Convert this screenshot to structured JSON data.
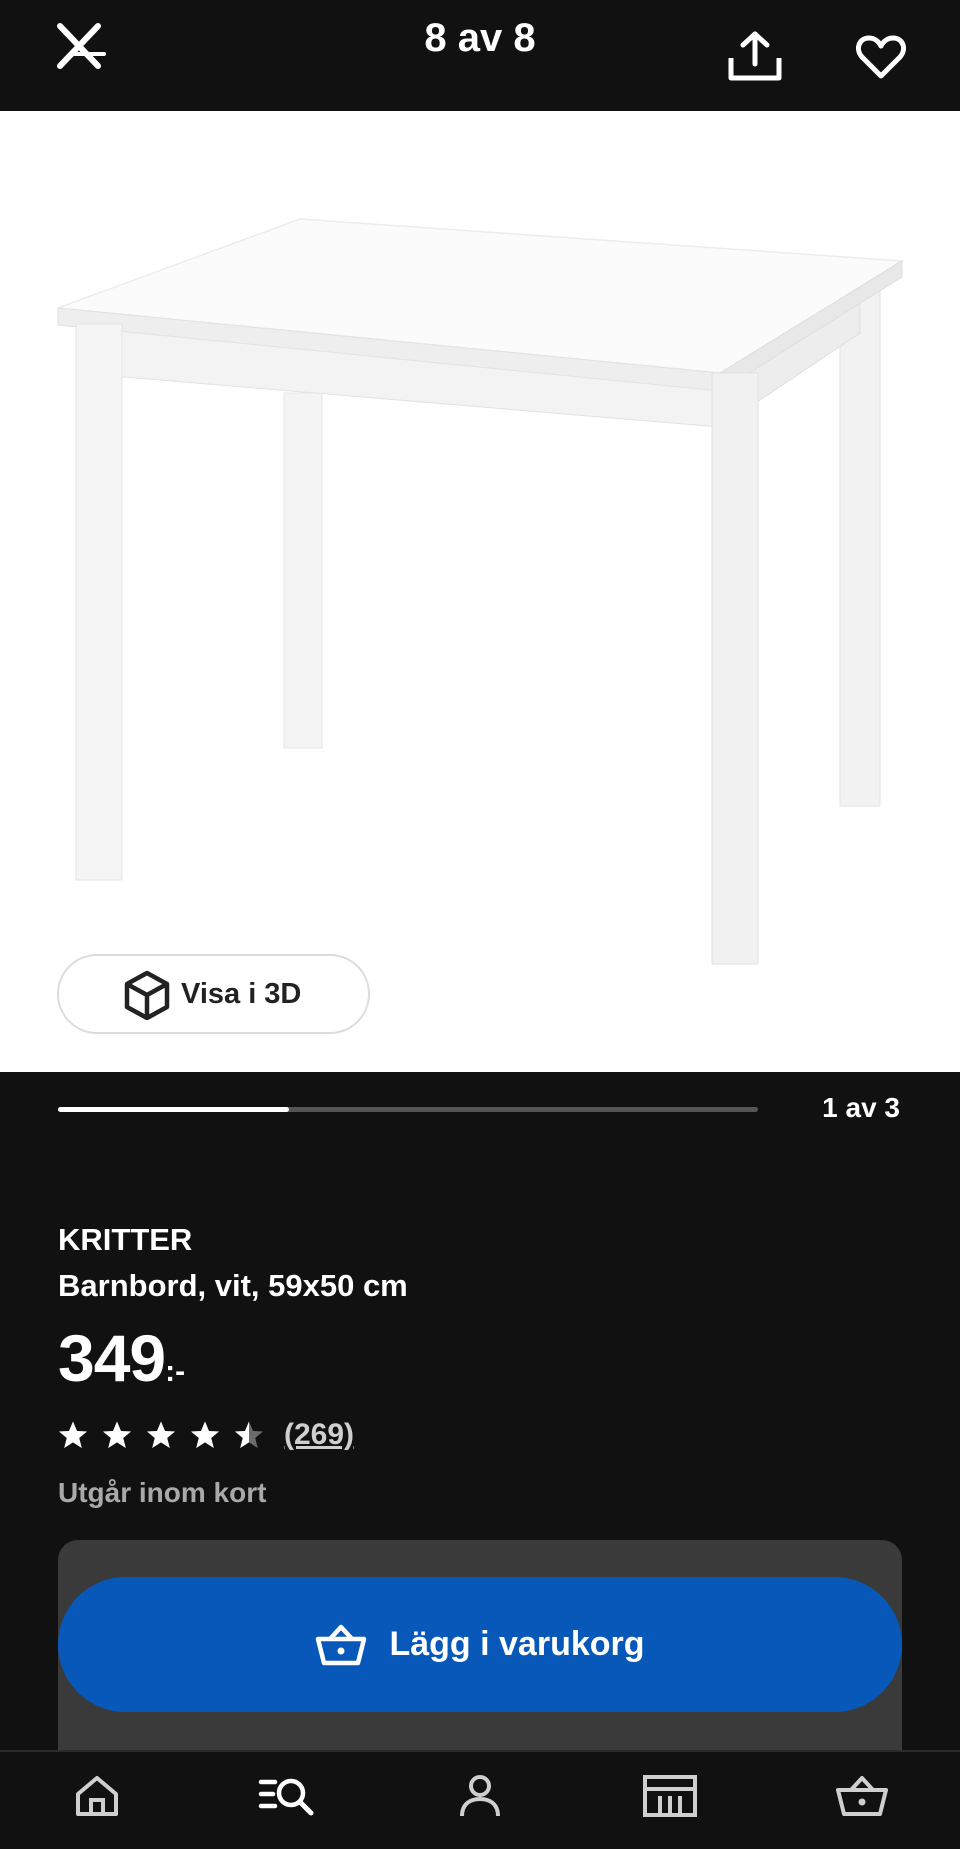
{
  "header": {
    "counter": "8 av 8",
    "close_icon": "close-x-icon",
    "share_icon": "share-icon",
    "favorite_icon": "heart-icon"
  },
  "gallery": {
    "view3d_label": "Visa i 3D",
    "view3d_icon": "cube-3d-icon",
    "slide_counter": "1 av 3",
    "slide_progress": 0.33
  },
  "product": {
    "brand": "KRITTER",
    "description": "Barnbord, vit, 59x50 cm",
    "price": "349",
    "price_suffix": ":-",
    "rating_value": 4.5,
    "rating_max": 5,
    "review_count": "(269)",
    "availability": "Utgår inom kort"
  },
  "cart": {
    "add_label": "Lägg i varukorg",
    "add_icon": "basket-icon",
    "button_color": "#0758b8"
  },
  "bottom_nav": [
    {
      "name": "home-icon"
    },
    {
      "name": "search-list-icon"
    },
    {
      "name": "profile-icon"
    },
    {
      "name": "store-icon"
    },
    {
      "name": "basket-icon"
    }
  ]
}
